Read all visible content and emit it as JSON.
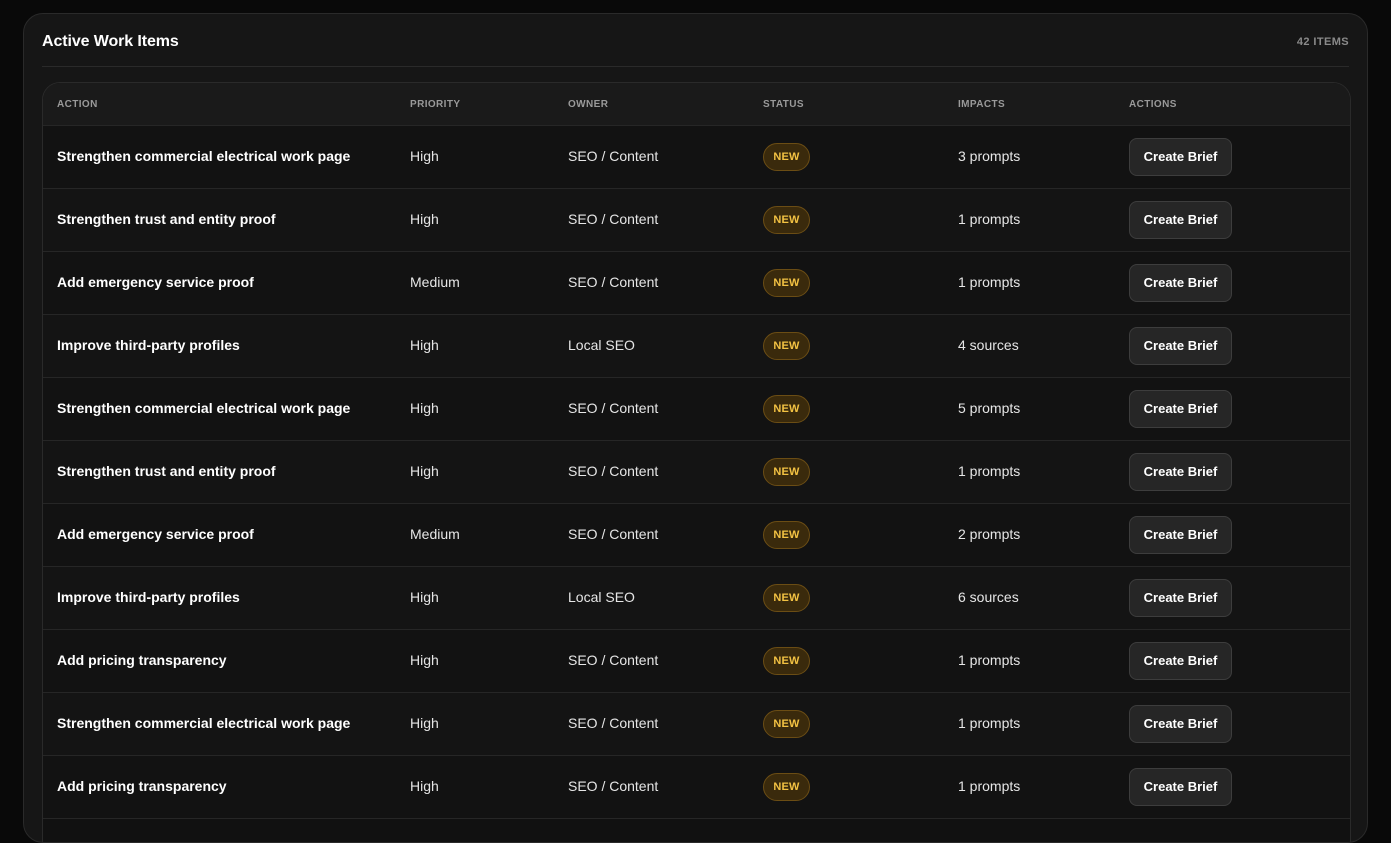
{
  "panel": {
    "title": "Active Work Items",
    "count": "42 ITEMS"
  },
  "table": {
    "columns": [
      "ACTION",
      "PRIORITY",
      "OWNER",
      "STATUS",
      "IMPACTS",
      "ACTIONS"
    ],
    "rows": [
      {
        "action": "Strengthen commercial electrical work page",
        "priority": "High",
        "owner": "SEO / Content",
        "status": "NEW",
        "impacts": "3 prompts",
        "button": "Create Brief"
      },
      {
        "action": "Strengthen trust and entity proof",
        "priority": "High",
        "owner": "SEO / Content",
        "status": "NEW",
        "impacts": "1 prompts",
        "button": "Create Brief"
      },
      {
        "action": "Add emergency service proof",
        "priority": "Medium",
        "owner": "SEO / Content",
        "status": "NEW",
        "impacts": "1 prompts",
        "button": "Create Brief"
      },
      {
        "action": "Improve third-party profiles",
        "priority": "High",
        "owner": "Local SEO",
        "status": "NEW",
        "impacts": "4 sources",
        "button": "Create Brief"
      },
      {
        "action": "Strengthen commercial electrical work page",
        "priority": "High",
        "owner": "SEO / Content",
        "status": "NEW",
        "impacts": "5 prompts",
        "button": "Create Brief"
      },
      {
        "action": "Strengthen trust and entity proof",
        "priority": "High",
        "owner": "SEO / Content",
        "status": "NEW",
        "impacts": "1 prompts",
        "button": "Create Brief"
      },
      {
        "action": "Add emergency service proof",
        "priority": "Medium",
        "owner": "SEO / Content",
        "status": "NEW",
        "impacts": "2 prompts",
        "button": "Create Brief"
      },
      {
        "action": "Improve third-party profiles",
        "priority": "High",
        "owner": "Local SEO",
        "status": "NEW",
        "impacts": "6 sources",
        "button": "Create Brief"
      },
      {
        "action": "Add pricing transparency",
        "priority": "High",
        "owner": "SEO / Content",
        "status": "NEW",
        "impacts": "1 prompts",
        "button": "Create Brief"
      },
      {
        "action": "Strengthen commercial electrical work page",
        "priority": "High",
        "owner": "SEO / Content",
        "status": "NEW",
        "impacts": "1 prompts",
        "button": "Create Brief"
      },
      {
        "action": "Add pricing transparency",
        "priority": "High",
        "owner": "SEO / Content",
        "status": "NEW",
        "impacts": "1 prompts",
        "button": "Create Brief"
      }
    ]
  },
  "colors": {
    "background": "#090909",
    "panel": "#161616",
    "badge_text": "#f3c243",
    "badge_bg": "#3a2a0c",
    "button_bg": "#262626"
  }
}
